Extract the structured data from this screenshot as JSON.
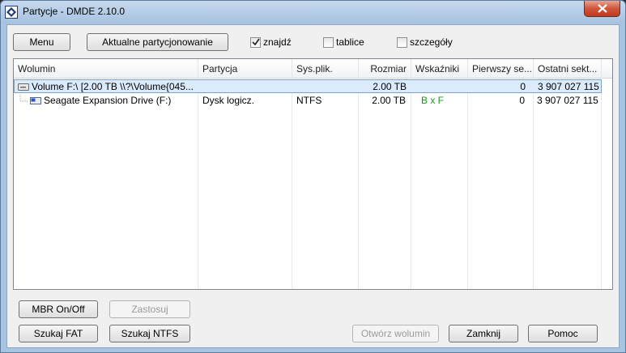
{
  "window": {
    "title": "Partycje - DMDE 2.10.0",
    "icon": "dmde-app-icon",
    "close_icon": "close-icon"
  },
  "toolbar": {
    "menu_label": "Menu",
    "current_partitioning_label": "Aktualne partycjonowanie",
    "checkboxes": [
      {
        "label": "znajdź",
        "checked": true
      },
      {
        "label": "tablice",
        "checked": false
      },
      {
        "label": "szczegóły",
        "checked": false
      }
    ]
  },
  "table": {
    "columns": [
      "Wolumin",
      "Partycja",
      "Sys.plik.",
      "Rozmiar",
      "Wskaźniki",
      "Pierwszy se...",
      "Ostatni sekt..."
    ],
    "rows": [
      {
        "icon": "volume-icon",
        "name": "Volume F:\\ [2.00 TB \\\\?\\Volume{045...",
        "partition": "",
        "fs": "",
        "size": "2.00 TB",
        "flags": "",
        "first": "0",
        "last": "3 907 027 115",
        "selected": true
      },
      {
        "icon": "drive-icon",
        "name": "Seagate Expansion Drive (F:)",
        "partition": "Dysk logicz.",
        "fs": "NTFS",
        "size": "2.00 TB",
        "flags": "B x F",
        "first": "0",
        "last": "3 907 027 115",
        "selected": false
      }
    ]
  },
  "buttons": {
    "mbr": "MBR On/Off",
    "apply": "Zastosuj",
    "search_fat": "Szukaj FAT",
    "search_ntfs": "Szukaj NTFS",
    "open_volume": "Otwórz wolumin",
    "close": "Zamknij",
    "help": "Pomoc"
  },
  "colors": {
    "flags_green": "#1a9a1a",
    "selection": "#dcebfc"
  }
}
